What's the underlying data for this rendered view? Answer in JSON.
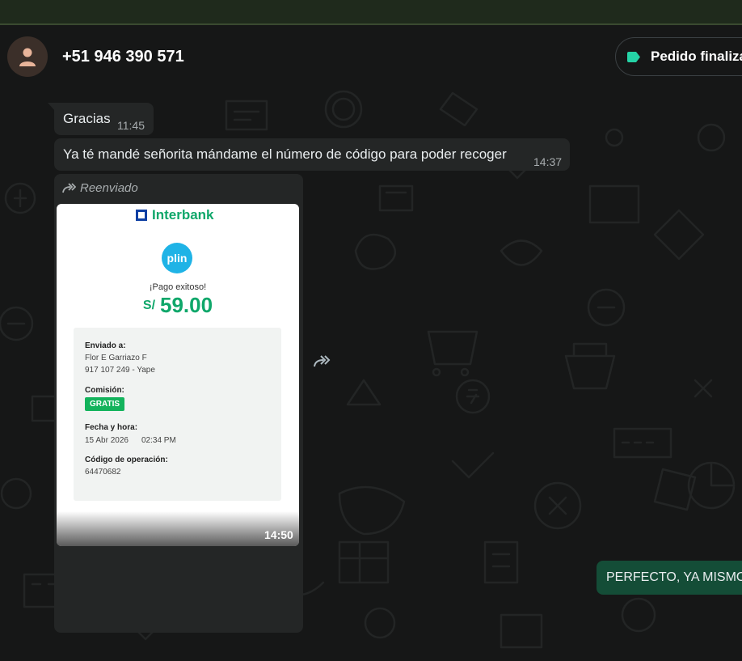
{
  "header": {
    "contact_name": "+51 946 390 571",
    "label_text": "Pedido finaliza",
    "label_color": "#25d3a6"
  },
  "messages": [
    {
      "text": "Gracias",
      "time": "11:45"
    },
    {
      "text": "Ya té mandé señorita mándame el número de código para poder recoger",
      "time": "14:37"
    }
  ],
  "forwarded_image": {
    "forwarded_label": "Reenviado",
    "time": "14:50",
    "receipt": {
      "bank": "Interbank",
      "app": "plin",
      "status": "¡Pago exitoso!",
      "currency": "S/",
      "amount": "59.00",
      "sent_to_label": "Enviado a:",
      "recipient": "Flor E Garriazo F",
      "recipient_phone": "917 107 249 - Yape",
      "commission_label": "Comisión:",
      "commission_value": "GRATIS",
      "datetime_label": "Fecha y hora:",
      "date": "15 Abr 2026",
      "time": "02:34 PM",
      "op_code_label": "Código de operación:",
      "op_code": "64470682"
    }
  },
  "outgoing": {
    "text": "PERFECTO, YA MISMO"
  },
  "colors": {
    "chat_bg": "#161717",
    "incoming_bubble": "#242626",
    "outgoing_bubble": "#144d37",
    "accent_green": "#0fa76a"
  }
}
